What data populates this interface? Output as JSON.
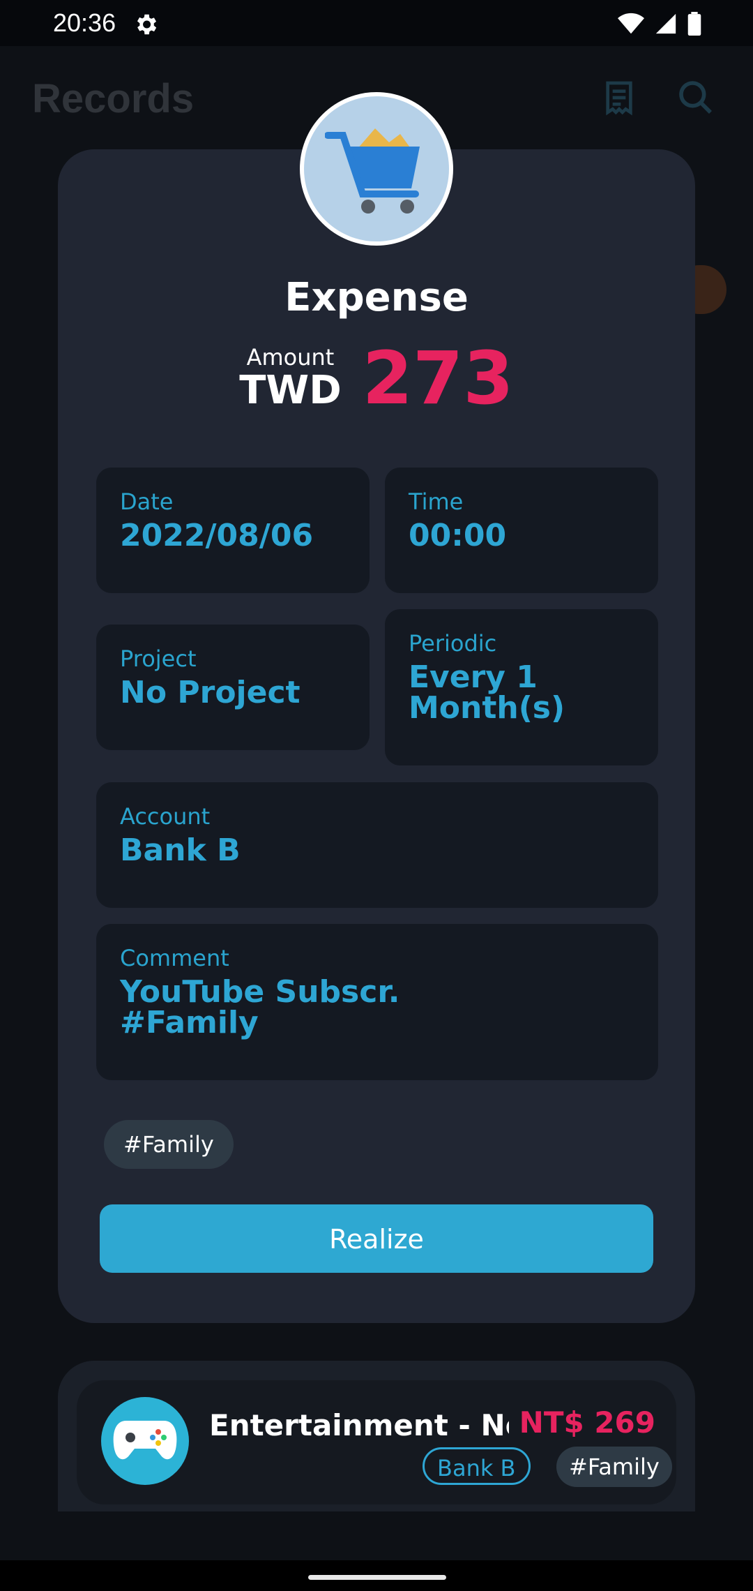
{
  "status_bar": {
    "time": "20:36"
  },
  "background": {
    "title": "Records"
  },
  "modal": {
    "title": "Expense",
    "amount_label": "Amount",
    "currency": "TWD",
    "amount": "273",
    "fields": {
      "date": {
        "label": "Date",
        "value": "2022/08/06"
      },
      "time": {
        "label": "Time",
        "value": "00:00"
      },
      "project": {
        "label": "Project",
        "value": "No Project"
      },
      "periodic": {
        "label": "Periodic",
        "value": "Every 1 Month(s)"
      },
      "account": {
        "label": "Account",
        "value": "Bank B"
      },
      "comment": {
        "label": "Comment",
        "value": "YouTube Subscr. #Family"
      }
    },
    "tag": "#Family",
    "realize_label": "Realize"
  },
  "list_item": {
    "title": "Entertainment - No Subscr.",
    "amount": "NT$ 269",
    "account": "Bank B",
    "tag": "#Family"
  },
  "colors": {
    "accent": "#2ea8d2",
    "expense": "#e7235f",
    "card": "#212633",
    "field": "#141922"
  }
}
